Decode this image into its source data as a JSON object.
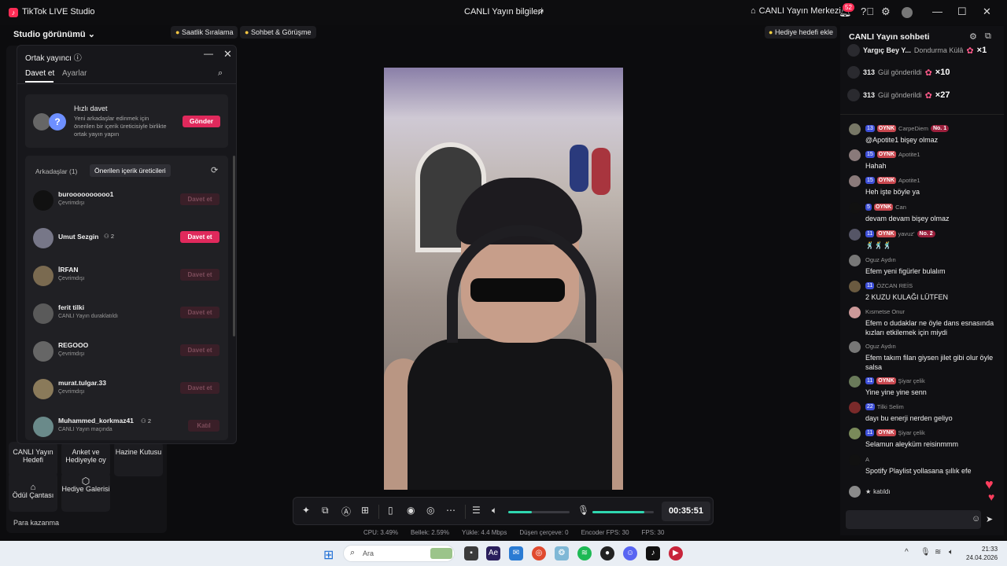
{
  "titlebar": {
    "app_title": "TikTok LIVE Studio",
    "live_info": "CANLI Yayın bilgileri",
    "center_label": "CANLI Yayın Merkezi",
    "notif_count": "52"
  },
  "left": {
    "studio_view": "Studio görünümü",
    "tiles": {
      "canli_yayin_hedefi": "CANLI Yayın Hedefi",
      "anket": "Anket ve Hediyeyle oy",
      "hazine": "Hazine Kutusu",
      "odul": "Ödül Çantası",
      "hediye_galerisi": "Hediye Galerisi"
    },
    "para_kazanma": "Para kazanma"
  },
  "pills": {
    "saatlik": "Saatlik Sıralama",
    "sohbet": "Sohbet & Görüşme",
    "hediye_hedefi": "Hediye hedefi ekle"
  },
  "guest_panel": {
    "title": "Ortak yayıncı",
    "tab_invite": "Davet et",
    "tab_settings": "Ayarlar",
    "quick_title": "Hızlı davet",
    "quick_desc": "Yeni arkadaşlar edinmek için önerilen bir içerik üreticisiyle birlikte ortak yayın yapın",
    "quick_send": "Gönder",
    "tab_friends": "Arkadaşlar (1)",
    "tab_suggested": "Önerilen içerik üreticileri",
    "users": [
      {
        "name": "buroooooooooo1",
        "status": "Çevrimdışı",
        "count": "",
        "btn": "Davet et",
        "active": false
      },
      {
        "name": "Umut Sezgin",
        "status": "",
        "count": "2",
        "btn": "Davet et",
        "active": true
      },
      {
        "name": "İRFAN",
        "status": "Çevrimdışı",
        "count": "",
        "btn": "Davet et",
        "active": false
      },
      {
        "name": "ferit tilki",
        "status": "CANLI Yayın duraklatıldı",
        "count": "",
        "btn": "Davet et",
        "active": false
      },
      {
        "name": "REGOOO",
        "status": "Çevrimdışı",
        "count": "",
        "btn": "Davet et",
        "active": false
      },
      {
        "name": "murat.tulgar.33",
        "status": "Çevrimdışı",
        "count": "",
        "btn": "Davet et",
        "active": false
      },
      {
        "name": "Muhammed_korkmaz41",
        "status": "CANLI Yayın maçında",
        "count": "2",
        "btn": "Katıl",
        "active": false
      }
    ]
  },
  "controls": {
    "timer": "00:35:51",
    "volume_level": 0.38,
    "mic_level": 0.85
  },
  "stats": {
    "cpu": "CPU: 3.49%",
    "memory": "Bellek: 2.59%",
    "upload": "Yükle: 4.4 Mbps",
    "dropped": "Düşen çerçeve: 0",
    "encoder": "Encoder FPS: 30",
    "fps": "FPS: 30"
  },
  "chat": {
    "title": "CANLI Yayın sohbeti",
    "gifts": [
      {
        "user": "Yargıç Bey Y...",
        "text": "Dondurma Külâ",
        "count": "×1"
      },
      {
        "user": "313",
        "text": "Gül gönderildi",
        "count": "×10"
      },
      {
        "user": "313",
        "text": "Gül gönderildi",
        "count": "×27"
      }
    ],
    "messages": [
      {
        "lvl": "13",
        "tag": "OYNK",
        "user": "CarpeDiem",
        "rank": "No. 1",
        "text": "@Apotite1 bişey olmaz"
      },
      {
        "lvl": "15",
        "tag": "OYNK",
        "user": "Apotite1",
        "rank": "",
        "text": "Hahah"
      },
      {
        "lvl": "15",
        "tag": "OYNK",
        "user": "Apotite1",
        "rank": "",
        "text": "Heh işte böyle ya"
      },
      {
        "lvl": "5",
        "tag": "OYNK",
        "user": "Can",
        "rank": "",
        "text": "devam devam bişey olmaz"
      },
      {
        "lvl": "11",
        "tag": "OYNK",
        "user": "yavuz'",
        "rank": "No. 2",
        "text": "🕺🕺🕺"
      },
      {
        "lvl": "",
        "tag": "",
        "user": "Oguz Aydın",
        "rank": "",
        "text": "Efem yeni figürler bulalım"
      },
      {
        "lvl": "11",
        "tag": "",
        "user": "ÖZCAN REİS",
        "rank": "",
        "text": "2 KUZU KULAĞI LÜTFEN"
      },
      {
        "lvl": "",
        "tag": "",
        "user": "Kısmetse Onur",
        "rank": "",
        "text": "Efem o dudaklar ne öyle dans esnasında kızları etkilemek için miydi"
      },
      {
        "lvl": "",
        "tag": "",
        "user": "Oguz Aydın",
        "rank": "",
        "text": "Efem takım filan giysen jilet gibi olur öyle salsa"
      },
      {
        "lvl": "11",
        "tag": "OYNK",
        "user": "Şiyar çelik",
        "rank": "",
        "text": "Yine yine yine senn"
      },
      {
        "lvl": "22",
        "tag": "",
        "user": "Tilki Selim",
        "rank": "",
        "text": "dayı bu enerji nerden geliyo"
      },
      {
        "lvl": "11",
        "tag": "OYNK",
        "user": "Şiyar çelik",
        "rank": "",
        "text": "Selamun aleyküm reisinmmm"
      },
      {
        "lvl": "",
        "tag": "",
        "user": "A",
        "rank": "",
        "text": "Spotify Playlist yollasana şıllık efe"
      }
    ],
    "joined": "katıldı"
  },
  "taskbar": {
    "search": "Ara",
    "time": "21:33",
    "date": "24.04.2026"
  }
}
